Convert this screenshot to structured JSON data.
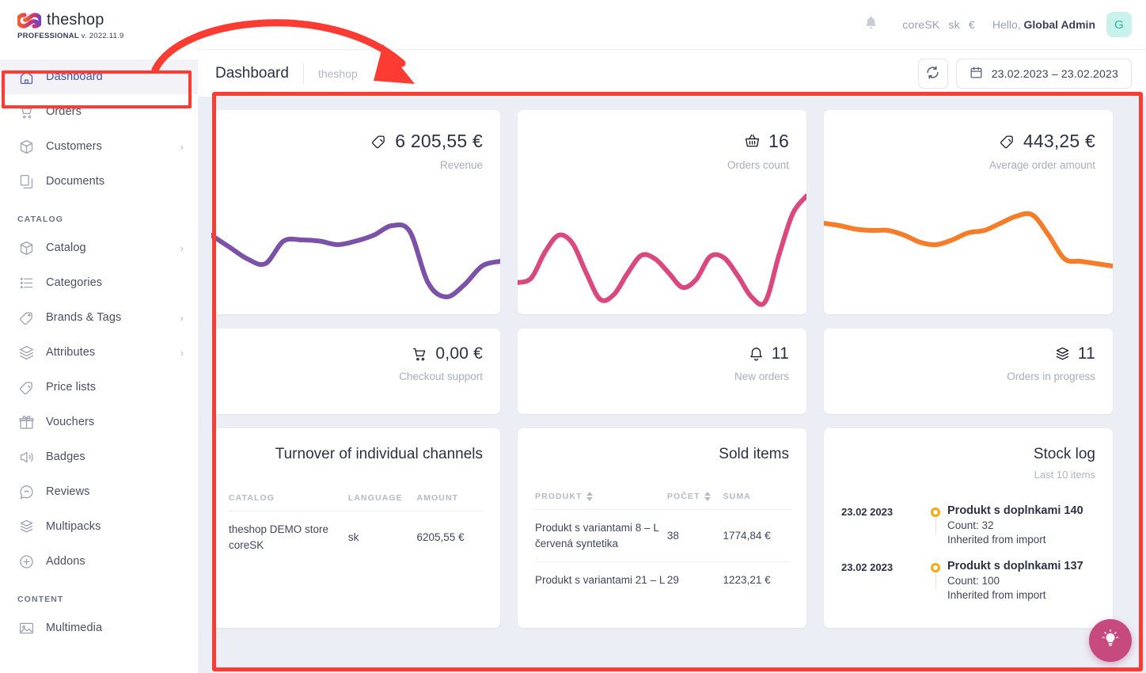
{
  "brand": {
    "name": "theshop",
    "edition": "PROFESSIONAL",
    "version": "v. 2022.11.9",
    "logo_icon": "infinity-loop-icon"
  },
  "topbar": {
    "bell_icon": "bell-icon",
    "context_shop": "coreSK",
    "context_lang": "sk",
    "context_currency": "€",
    "greeting_prefix": "Hello,",
    "user_name": "Global Admin",
    "avatar_initial": "G"
  },
  "pagehead": {
    "title": "Dashboard",
    "subtitle": "theshop",
    "refresh_icon": "refresh-icon",
    "calendar_icon": "calendar-icon",
    "date_range": "23.02.2023 – 23.02.2023"
  },
  "sidebar": {
    "items": [
      {
        "label": "Dashboard",
        "icon": "home-icon",
        "active": true,
        "chevron": false
      },
      {
        "label": "Orders",
        "icon": "cart-icon",
        "active": false,
        "chevron": false
      },
      {
        "label": "Customers",
        "icon": "box-icon",
        "active": false,
        "chevron": true
      },
      {
        "label": "Documents",
        "icon": "documents-icon",
        "active": false,
        "chevron": false
      }
    ],
    "sections": [
      {
        "label": "CATALOG",
        "items": [
          {
            "label": "Catalog",
            "icon": "box-icon",
            "chevron": true
          },
          {
            "label": "Categories",
            "icon": "list-icon",
            "chevron": false
          },
          {
            "label": "Brands & Tags",
            "icon": "tag-icon",
            "chevron": true
          },
          {
            "label": "Attributes",
            "icon": "layers-icon",
            "chevron": true
          },
          {
            "label": "Price lists",
            "icon": "pricetag-icon",
            "chevron": false
          },
          {
            "label": "Vouchers",
            "icon": "gift-icon",
            "chevron": false
          },
          {
            "label": "Badges",
            "icon": "megaphone-icon",
            "chevron": false
          },
          {
            "label": "Reviews",
            "icon": "comment-icon",
            "chevron": false
          },
          {
            "label": "Multipacks",
            "icon": "multipack-icon",
            "chevron": false
          },
          {
            "label": "Addons",
            "icon": "plus-circle-icon",
            "chevron": false
          }
        ]
      },
      {
        "label": "CONTENT",
        "items": [
          {
            "label": "Multimedia",
            "icon": "media-icon",
            "chevron": false
          }
        ]
      }
    ]
  },
  "kpis_big": [
    {
      "value": "6 205,55 €",
      "label": "Revenue",
      "icon": "pricetag-icon",
      "color": "#7b52a8"
    },
    {
      "value": "16",
      "label": "Orders count",
      "icon": "basket-icon",
      "color": "#d9487e"
    },
    {
      "value": "443,25 €",
      "label": "Average order amount",
      "icon": "pricetag-icon",
      "color": "#f57c29"
    }
  ],
  "kpis_small": [
    {
      "value": "0,00 €",
      "label": "Checkout support",
      "icon": "cart-icon"
    },
    {
      "value": "11",
      "label": "New orders",
      "icon": "bell-icon"
    },
    {
      "value": "11",
      "label": "Orders in progress",
      "icon": "multipack-icon"
    }
  ],
  "turnover": {
    "title": "Turnover of individual channels",
    "columns": [
      "CATALOG",
      "LANGUAGE",
      "AMOUNT"
    ],
    "rows": [
      [
        "theshop DEMO store coreSK",
        "sk",
        "6205,55 €"
      ]
    ]
  },
  "sold_items": {
    "title": "Sold items",
    "columns": [
      "PRODUKT",
      "POČET",
      "SUMA"
    ],
    "rows": [
      [
        "Produkt s variantami 8 – L červená syntetika",
        "38",
        "1774,84 €"
      ],
      [
        "Produkt s variantami 21 – L",
        "29",
        "1223,21 €"
      ]
    ]
  },
  "stock_log": {
    "title": "Stock log",
    "subtitle": "Last 10 items",
    "entries": [
      {
        "date": "23.02 2023",
        "product": "Produkt s doplnkami 140",
        "count": "Count: 32",
        "note": "Inherited from import"
      },
      {
        "date": "23.02 2023",
        "product": "Produkt s doplnkami 137",
        "count": "Count: 100",
        "note": "Inherited from import"
      }
    ]
  },
  "fab": {
    "icon": "lightbulb-icon"
  },
  "annotations": {
    "color": "#fc3b33"
  },
  "chart_data": [
    {
      "type": "line",
      "title": "Revenue",
      "color": "#7b52a8",
      "y": [
        62,
        52,
        42,
        38,
        57,
        58,
        57,
        54,
        57,
        62,
        70,
        65,
        22,
        10,
        20,
        36,
        40
      ],
      "ylim": [
        0,
        100
      ],
      "grid": false,
      "legend": "none",
      "xlabel": "",
      "ylabel": ""
    },
    {
      "type": "line",
      "title": "Orders count",
      "color": "#d9487e",
      "y": [
        22,
        26,
        48,
        62,
        55,
        30,
        8,
        12,
        30,
        45,
        42,
        30,
        18,
        25,
        44,
        43,
        28,
        10,
        6,
        45,
        80,
        95
      ],
      "ylim": [
        0,
        100
      ],
      "grid": false,
      "legend": "none",
      "xlabel": "",
      "ylabel": ""
    },
    {
      "type": "line",
      "title": "Average order amount",
      "color": "#f57c29",
      "y": [
        72,
        70,
        67,
        66,
        66,
        62,
        56,
        54,
        58,
        64,
        66,
        72,
        78,
        79,
        62,
        42,
        40,
        38,
        36
      ],
      "ylim": [
        0,
        100
      ],
      "grid": false,
      "legend": "none",
      "xlabel": "",
      "ylabel": ""
    }
  ]
}
